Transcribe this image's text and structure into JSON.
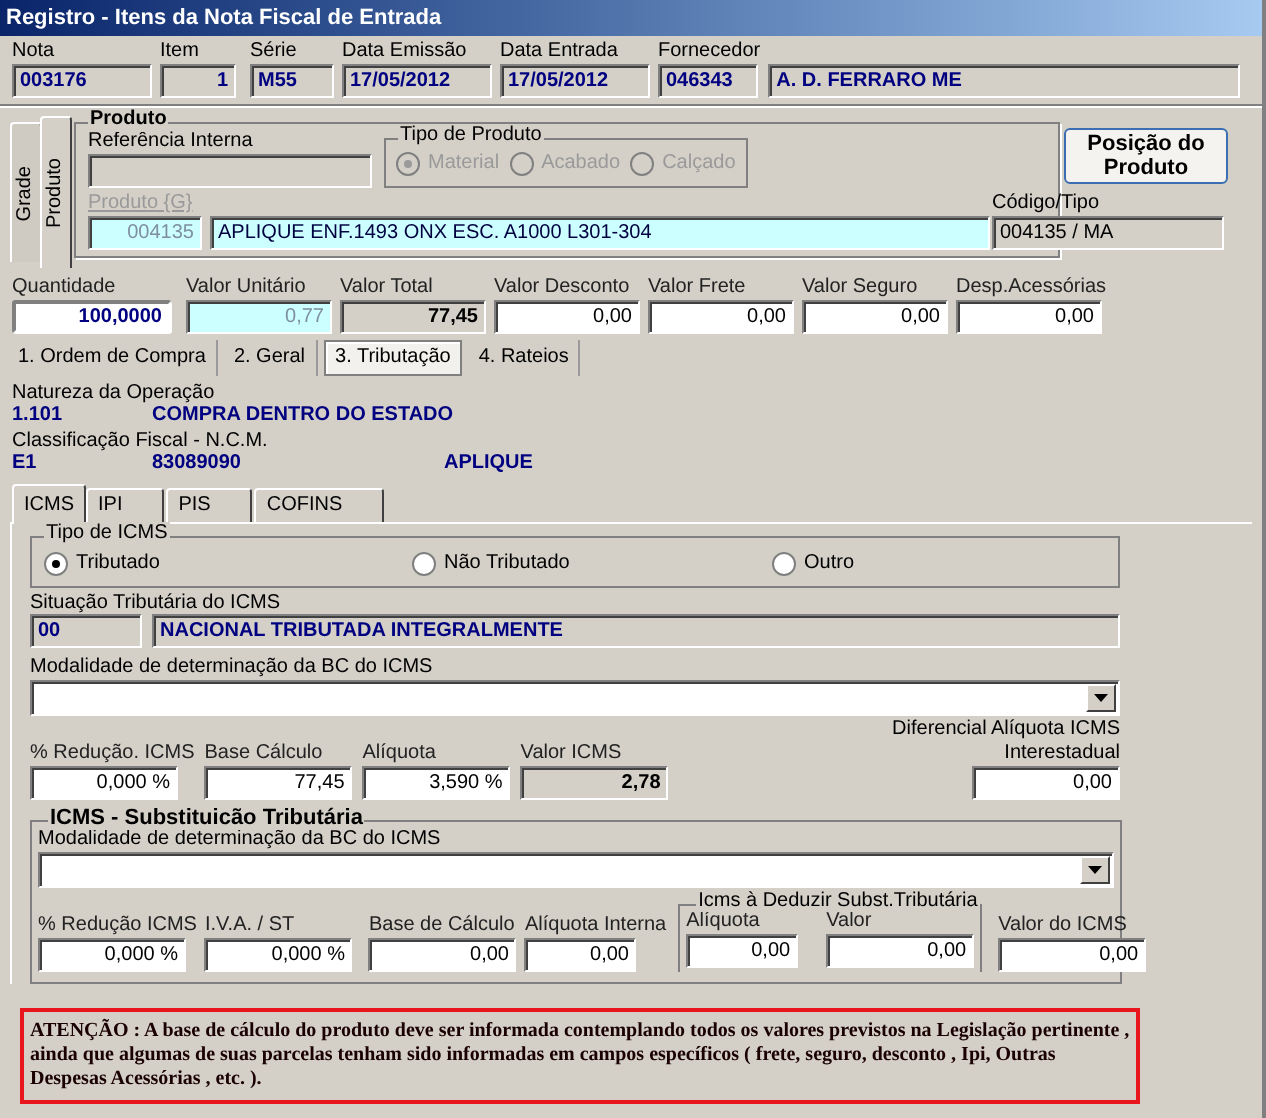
{
  "window": {
    "title": "Registro - Itens da Nota Fiscal de Entrada"
  },
  "header_fields": [
    {
      "label": "Nota",
      "value": "003176"
    },
    {
      "label": "Item",
      "value": "1"
    },
    {
      "label": "Série",
      "value": "M55"
    },
    {
      "label": "Data Emissão",
      "value": "17/05/2012"
    },
    {
      "label": "Data Entrada",
      "value": "17/05/2012"
    },
    {
      "label": "Fornecedor",
      "value": "046343"
    },
    {
      "value": "A. D. FERRARO ME"
    }
  ],
  "side_tabs": [
    {
      "label": "Grade",
      "selected": false
    },
    {
      "label": "Produto",
      "selected": true
    }
  ],
  "produto": {
    "title": "Produto",
    "referencia_label": "Referência Interna",
    "tipo_produto": {
      "title": "Tipo de Produto",
      "disabled": true,
      "options": [
        {
          "label": "Material",
          "selected": true
        },
        {
          "label": "Acabado",
          "selected": false
        },
        {
          "label": "Calçado",
          "selected": false
        }
      ]
    },
    "position_button": "Posição do Produto",
    "produto_label": "Produto {G}",
    "produto_code": "004135",
    "produto_description": "APLIQUE ENF.1493 ONX ESC. A1000 L301-304",
    "codigo_label": "Código/Tipo",
    "codigo_value": "004135 / MA"
  },
  "value_fields": [
    {
      "label": "Quantidade",
      "value": "100,0000",
      "kind": "focused"
    },
    {
      "label": "Valor Unitário",
      "value": "0,77",
      "kind": "cyan"
    },
    {
      "label": "Valor Total",
      "value": "77,45",
      "kind": "readonly"
    },
    {
      "label": "Valor Desconto",
      "value": "0,00",
      "kind": "input"
    },
    {
      "label": "Valor Frete",
      "value": "0,00",
      "kind": "input"
    },
    {
      "label": "Valor Seguro",
      "value": "0,00",
      "kind": "input"
    },
    {
      "label": "Desp.Acessórias",
      "value": "0,00",
      "kind": "input"
    }
  ],
  "main_tabs": [
    {
      "label": "1. Ordem de Compra",
      "selected": false
    },
    {
      "label": "2. Geral",
      "selected": false
    },
    {
      "label": "3. Tributação",
      "selected": true
    },
    {
      "label": "4. Rateios",
      "selected": false
    }
  ],
  "natureza": {
    "label": "Natureza da Operação",
    "code": "1.101",
    "description": "COMPRA DENTRO DO ESTADO"
  },
  "classificacao": {
    "label": "Classificação Fiscal - N.C.M.",
    "code": "E1",
    "ncm": "83089090",
    "description": "APLIQUE"
  },
  "tax_tabs": [
    {
      "label": "ICMS",
      "selected": true
    },
    {
      "label": "IPI",
      "selected": false
    },
    {
      "label": "PIS",
      "selected": false
    },
    {
      "label": "COFINS",
      "selected": false
    }
  ],
  "tipo_icms": {
    "title": "Tipo de ICMS",
    "options": [
      {
        "label": "Tributado",
        "selected": true
      },
      {
        "label": "Não Tributado",
        "selected": false
      },
      {
        "label": "Outro",
        "selected": false
      }
    ]
  },
  "situacao": {
    "label": "Situação Tributária do ICMS",
    "code": "00",
    "description": "NACIONAL TRIBUTADA INTEGRALMENTE"
  },
  "modalidade": {
    "label": "Modalidade de determinação da BC do ICMS"
  },
  "icms_fields": [
    {
      "label": "% Redução. ICMS",
      "value": "0,000 %",
      "kind": "input"
    },
    {
      "label": "Base Cálculo",
      "value": "77,45",
      "kind": "input"
    },
    {
      "label": "Alíquota",
      "value": "3,590 %",
      "kind": "input"
    },
    {
      "label": "Valor ICMS",
      "value": "2,78",
      "kind": "readonly"
    }
  ],
  "diferencial": {
    "label_1": "Diferencial Alíquota ICMS",
    "label_2": "Interestadual",
    "value": "0,00"
  },
  "st": {
    "title": "ICMS - Substituicão Tributária",
    "modalidade_label": "Modalidade de determinação da BC do ICMS",
    "fields": [
      {
        "label": "% Redução ICMS",
        "value": "0,000 %"
      },
      {
        "label": "I.V.A. / ST",
        "value": "0,000 %"
      },
      {
        "label": "Base de Cálculo",
        "value": "0,00"
      },
      {
        "label": "Alíquota Interna",
        "value": "0,00"
      }
    ],
    "deduzir": {
      "title": "Icms à Deduzir Subst.Tributária",
      "fields": [
        {
          "label": "Alíquota",
          "value": "0,00"
        },
        {
          "label": "Valor",
          "value": "0,00"
        }
      ]
    },
    "valor": {
      "label": "Valor do ICMS",
      "value": "0,00"
    }
  },
  "warning": "ATENÇÃO : A base de cálculo do produto deve ser informada  contemplando todos os valores previstos na Legislação pertinente , ainda que algumas de suas parcelas tenham sido informadas em campos específicos ( frete, seguro, desconto , Ipi, Outras Despesas Acessórias , etc. )."
}
